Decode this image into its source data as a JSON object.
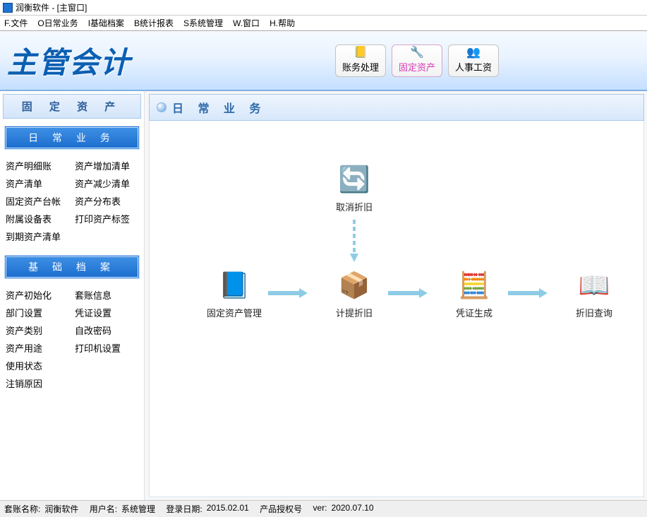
{
  "window": {
    "title": "润衡软件 - [主窗口]"
  },
  "menu": {
    "file": "F.文件",
    "daily": "O日常业务",
    "base": "I基础档案",
    "report": "B统计报表",
    "system": "S系统管理",
    "window": "W.窗口",
    "help": "H.帮助"
  },
  "header": {
    "logo": "主管会计",
    "btn1": "账务处理",
    "btn2": "固定资产",
    "btn3": "人事工资"
  },
  "sidebar": {
    "title": "固 定 资 产",
    "sec1": {
      "title": "日 常 业 务",
      "left": [
        "资产明细账",
        "资产清单",
        "固定资产台帐",
        "附属设备表",
        "到期资产清单"
      ],
      "right": [
        "资产增加清单",
        "资产减少清单",
        "资产分布表",
        "打印资产标签"
      ]
    },
    "sec2": {
      "title": "基 础 档 案",
      "left": [
        "资产初始化",
        "部门设置",
        "资产类别",
        "资产用途",
        "使用状态",
        "注销原因"
      ],
      "right": [
        "套账信息",
        "凭证设置",
        "自改密码",
        "打印机设置"
      ]
    }
  },
  "main": {
    "title": "日 常 业 务",
    "nodes": {
      "cancel_depr": "取消折旧",
      "asset_mgmt": "固定资产管理",
      "calc_depr": "计提折旧",
      "voucher": "凭证生成",
      "depr_query": "折旧查询"
    }
  },
  "status": {
    "book_label": "套账名称:",
    "book_value": "润衡软件",
    "user_label": "用户名:",
    "user_value": "系统管理",
    "date_label": "登录日期:",
    "date_value": "2015.02.01",
    "lic_label": "产品授权号",
    "ver_label": "ver:",
    "ver_value": "2020.07.10"
  }
}
